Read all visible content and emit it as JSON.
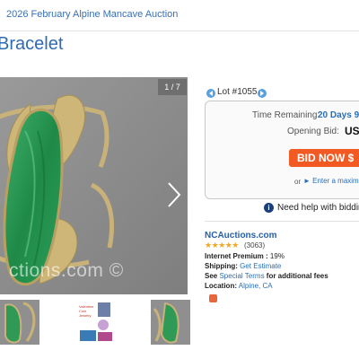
{
  "header": {
    "breadcrumb": "2026 February Alpine Mancave Auction",
    "title": "Bracelet"
  },
  "gallery": {
    "counter": "1 / 7",
    "watermark": "ctions.com ©",
    "next_icon": "chevron-right-icon",
    "thumbnail_count": 3
  },
  "lot": {
    "label": "Lot #1055",
    "prev_icon": "arrow-left-icon",
    "next_icon": "arrow-right-icon"
  },
  "bid_box": {
    "time_remaining_label": "Time Remaining:",
    "time_remaining_value": "20 Days 9 H",
    "opening_bid_label": "Opening Bid:",
    "opening_bid_value": "US",
    "bid_button_label": "BID NOW $",
    "or_text": "or",
    "max_link": "Enter a maximu"
  },
  "help": {
    "icon": "info-icon",
    "text": "Need help with biddin"
  },
  "seller": {
    "name": "NCAuctions.com",
    "stars": "★★★★★",
    "rating_count": "(3063)",
    "internet_premium_label": "Internet Premium :",
    "internet_premium_value": "19%",
    "shipping_label": "Shipping:",
    "shipping_value": "Get Estimate",
    "see_text": "See",
    "special_terms_link": "Special Terms",
    "additional_fees_text": "for additional fees",
    "location_label": "Location:",
    "location_value": "Alpine, CA"
  },
  "colors": {
    "link_blue": "#2a6fb7",
    "bid_orange": "#f15a22",
    "star_gold": "#f5a623",
    "malachite_green": "#2e9a56",
    "brass": "#c9b27a"
  }
}
